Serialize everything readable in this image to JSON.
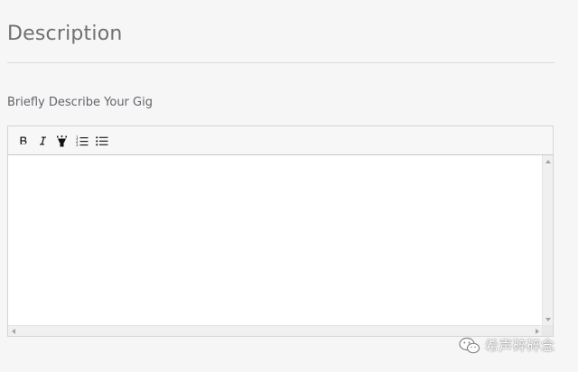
{
  "section": {
    "title": "Description"
  },
  "field": {
    "label": "Briefly Describe Your Gig"
  },
  "editor": {
    "toolbar": [
      {
        "name": "bold-button",
        "icon": "bold-icon"
      },
      {
        "name": "italic-button",
        "icon": "italic-icon"
      },
      {
        "name": "highlight-button",
        "icon": "highlighter-icon"
      },
      {
        "name": "ordered-list-button",
        "icon": "ordered-list-icon"
      },
      {
        "name": "bullet-list-button",
        "icon": "bullet-list-icon"
      }
    ],
    "content": ""
  },
  "watermark": {
    "text": "希声碎碎念",
    "icon": "wechat-icon"
  },
  "colors": {
    "page_background": "#f6f6f6",
    "title_text": "#6f6f72",
    "label_text": "#62646a",
    "editor_border": "#d4d4d4"
  }
}
